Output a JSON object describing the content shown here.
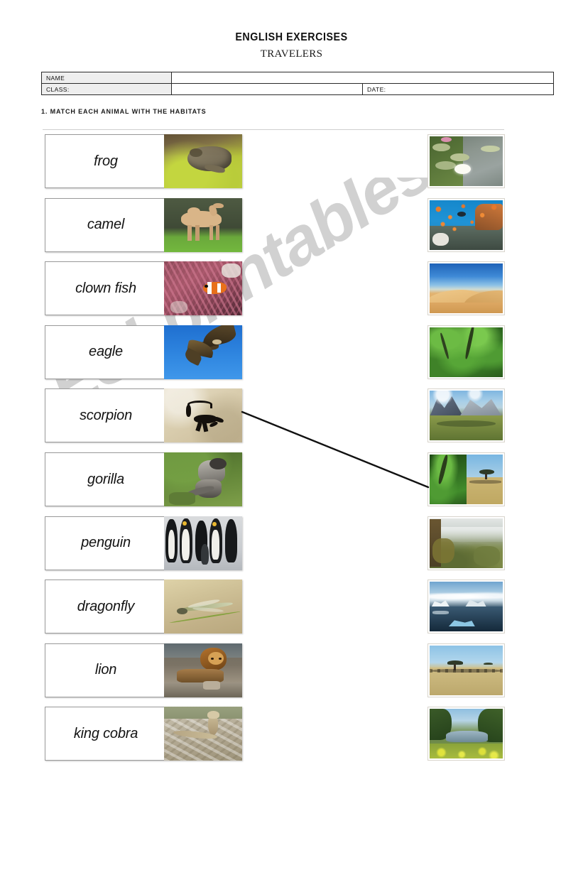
{
  "header": {
    "title": "ENGLISH EXERCISES",
    "subtitle": "TRAVELERS"
  },
  "info_table": {
    "name_label": "NAME",
    "name_value": "",
    "class_label": "CLASS:",
    "class_value": "",
    "date_label": "DATE:",
    "date_value": ""
  },
  "instruction": "1. MATCH EACH ANIMAL WITH THE HABITATS",
  "watermark": "ESLprintables.com",
  "animals": [
    {
      "label": "frog",
      "photo": "frog-on-moss-photo"
    },
    {
      "label": "camel",
      "photo": "camel-on-grass-photo"
    },
    {
      "label": "clown fish",
      "photo": "clown-fish-anemone-photo"
    },
    {
      "label": "eagle",
      "photo": "eagle-flying-photo"
    },
    {
      "label": "scorpion",
      "photo": "scorpion-on-sand-photo"
    },
    {
      "label": "gorilla",
      "photo": "gorilla-photo"
    },
    {
      "label": "penguin",
      "photo": "penguins-group-photo"
    },
    {
      "label": "dragonfly",
      "photo": "dragonfly-on-stem-photo"
    },
    {
      "label": "lion",
      "photo": "lion-resting-photo"
    },
    {
      "label": "king cobra",
      "photo": "king-cobra-photo"
    }
  ],
  "habitats": [
    {
      "name": "pond-water-lilies-photo"
    },
    {
      "name": "coral-reef-photo"
    },
    {
      "name": "desert-dunes-photo"
    },
    {
      "name": "jungle-photo"
    },
    {
      "name": "mountains-photo"
    },
    {
      "name": "jungle-savanna-split-photo"
    },
    {
      "name": "forest-hills-mist-photo"
    },
    {
      "name": "arctic-icebergs-photo"
    },
    {
      "name": "savanna-acacia-photo"
    },
    {
      "name": "river-wetland-photo"
    }
  ],
  "connections": [
    {
      "from": "scorpion",
      "to": "jungle-savanna-split-photo"
    }
  ],
  "colors": {
    "line": "#111111",
    "table_label_bg": "#eeeeee",
    "rule": "#cfcfcf",
    "watermark": "#c9c9c9"
  }
}
